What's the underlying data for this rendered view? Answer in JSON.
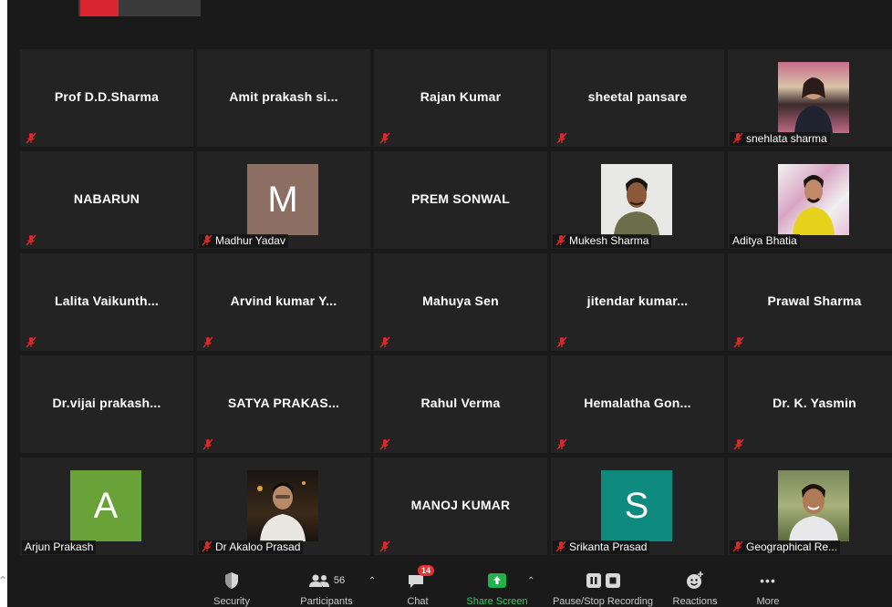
{
  "colors": {
    "background": "#1a1a1a",
    "tile": "#232323",
    "mute_red": "#e02828",
    "share_green": "#22b24c",
    "badge_red": "#e8312e"
  },
  "participants": [
    {
      "id": "t1",
      "name": "Prof D.D.Sharma",
      "muted": true
    },
    {
      "id": "t2",
      "name": "Amit prakash si...",
      "muted": false
    },
    {
      "id": "t3",
      "name": "Rajan Kumar",
      "muted": true
    },
    {
      "id": "t4",
      "name": "sheetal pansare",
      "muted": true
    },
    {
      "id": "t5",
      "label": "snehlata sharma",
      "muted": true,
      "video": "photo-woman-with-flowers"
    },
    {
      "id": "t6",
      "name": "NABARUN",
      "muted": true
    },
    {
      "id": "t7",
      "label": "Madhur Yadav",
      "muted": true,
      "avatar_letter": "M",
      "avatar_color": "#8c6e63"
    },
    {
      "id": "t8",
      "name": "PREM SONWAL",
      "muted": false
    },
    {
      "id": "t9",
      "label": "Mukesh Sharma",
      "muted": true,
      "video": "photo-man-portrait"
    },
    {
      "id": "t10",
      "label": "Aditya Bhatia",
      "muted": false,
      "video": "photo-man-yellow-shirt"
    },
    {
      "id": "t11",
      "name": "Lalita  Vaikunth...",
      "muted": true
    },
    {
      "id": "t12",
      "name": "Arvind kumar Y...",
      "muted": true
    },
    {
      "id": "t13",
      "name": "Mahuya Sen",
      "muted": true
    },
    {
      "id": "t14",
      "name": "jitendar  kumar...",
      "muted": true
    },
    {
      "id": "t15",
      "name": "Prawal Sharma",
      "muted": true
    },
    {
      "id": "t16",
      "name": "Dr.vijai  prakash...",
      "muted": false
    },
    {
      "id": "t17",
      "name": "SATYA  PRAKAS...",
      "muted": true
    },
    {
      "id": "t18",
      "name": "Rahul Verma",
      "muted": true
    },
    {
      "id": "t19",
      "name": "Hemalatha  Gon...",
      "muted": true
    },
    {
      "id": "t20",
      "name": "Dr. K. Yasmin",
      "muted": true
    },
    {
      "id": "t21",
      "label": "Arjun Prakash",
      "muted": false,
      "avatar_letter": "A",
      "avatar_color": "#6aa23a"
    },
    {
      "id": "t22",
      "label": "Dr Akaloo Prasad",
      "muted": true,
      "video": "photo-man-glasses-dark"
    },
    {
      "id": "t23",
      "name": "MANOJ KUMAR",
      "muted": true
    },
    {
      "id": "t24",
      "label": "Srikanta Prasad",
      "muted": true,
      "avatar_letter": "S",
      "avatar_color": "#0e8a7e"
    },
    {
      "id": "t25",
      "label": "Geographical Re...",
      "muted": true,
      "video": "photo-man-outdoor"
    }
  ],
  "toolbar": {
    "security": {
      "label": "Security",
      "icon": "shield-icon"
    },
    "participants": {
      "label": "Participants",
      "count": "56",
      "icon": "participants-icon"
    },
    "chat": {
      "label": "Chat",
      "badge": "14",
      "icon": "chat-icon"
    },
    "share_screen": {
      "label": "Share Screen",
      "icon": "share-screen-icon"
    },
    "recording": {
      "label": "Pause/Stop Recording",
      "icon": "pause-stop-icon"
    },
    "reactions": {
      "label": "Reactions",
      "icon": "reactions-icon"
    },
    "more": {
      "label": "More",
      "icon": "more-icon"
    }
  }
}
